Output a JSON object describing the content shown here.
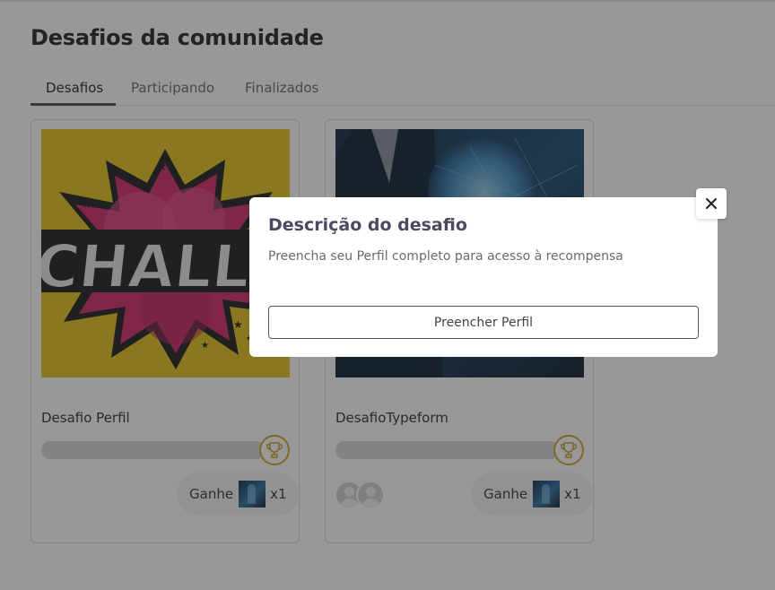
{
  "page": {
    "title": "Desafios da comunidade"
  },
  "tabs": [
    {
      "label": "Desafios",
      "active": true
    },
    {
      "label": "Participando",
      "active": false
    },
    {
      "label": "Finalizados",
      "active": false
    }
  ],
  "cards": [
    {
      "title": "Desafio Perfil",
      "image_text": "CHALLENG",
      "progress": 0,
      "reward_label": "Ganhe",
      "reward_qty": "x1",
      "participants": 0
    },
    {
      "title": "DesafioTypeform",
      "progress": 0,
      "reward_label": "Ganhe",
      "reward_qty": "x1",
      "participants": 2
    }
  ],
  "modal": {
    "title": "Descrição do desafio",
    "description": "Preencha seu Perfil completo para acesso à recompensa",
    "button_label": "Preencher Perfil"
  },
  "icons": {
    "close": "close-icon",
    "trophy": "trophy-icon",
    "avatar": "user-avatar-icon"
  },
  "colors": {
    "accent_gold": "#c9a227",
    "challenge_yellow": "#e3c21a",
    "challenge_pink": "#d4266b"
  }
}
